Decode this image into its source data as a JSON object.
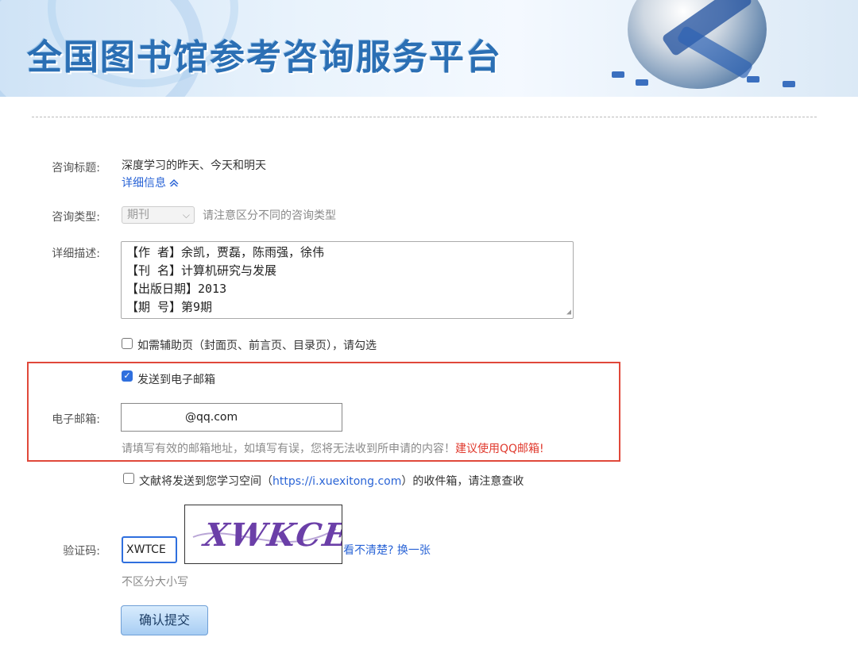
{
  "banner": {
    "title": "全国图书馆参考咨询服务平台"
  },
  "form": {
    "title_label": "咨询标题:",
    "title_value": "深度学习的昨天、今天和明天",
    "detail_link": "详细信息",
    "detail_icon": "chevron-up",
    "type_label": "咨询类型:",
    "type_selected": "期刊",
    "type_hint": "请注意区分不同的咨询类型",
    "desc_label": "详细描述:",
    "desc_lines": [
      "【作 者】余凯，贾磊，陈雨强，徐伟",
      "【刊 名】计算机研究与发展",
      "【出版日期】2013",
      "【期 号】第9期"
    ],
    "aux_checkbox_label": "如需辅助页（封面页、前言页、目录页），请勾选",
    "aux_checked": false,
    "send_email_label": "发送到电子邮箱",
    "send_email_checked": true,
    "email_label": "电子邮箱:",
    "email_value": "@qq.com",
    "email_hint": "请填写有效的邮箱地址，如填写有误，您将无法收到所申请的内容！",
    "email_hint_red": "建议使用QQ邮箱!",
    "space_checkbox_prefix": "文献将发送到您学习空间（",
    "space_link": "https://i.xuexitong.com",
    "space_checkbox_suffix": "）的收件箱，请注意查收",
    "space_checked": false,
    "captcha_label": "验证码:",
    "captcha_value": "XWTCE",
    "captcha_image_text": "XWKCE",
    "captcha_refresh": "看不清楚? 换一张",
    "captcha_hint": "不区分大小写",
    "submit_label": "确认提交"
  },
  "colors": {
    "accent": "#2f6fde",
    "highlight_box": "#e0483a",
    "warning_text": "#e03a2e",
    "link": "#2a64d6"
  }
}
